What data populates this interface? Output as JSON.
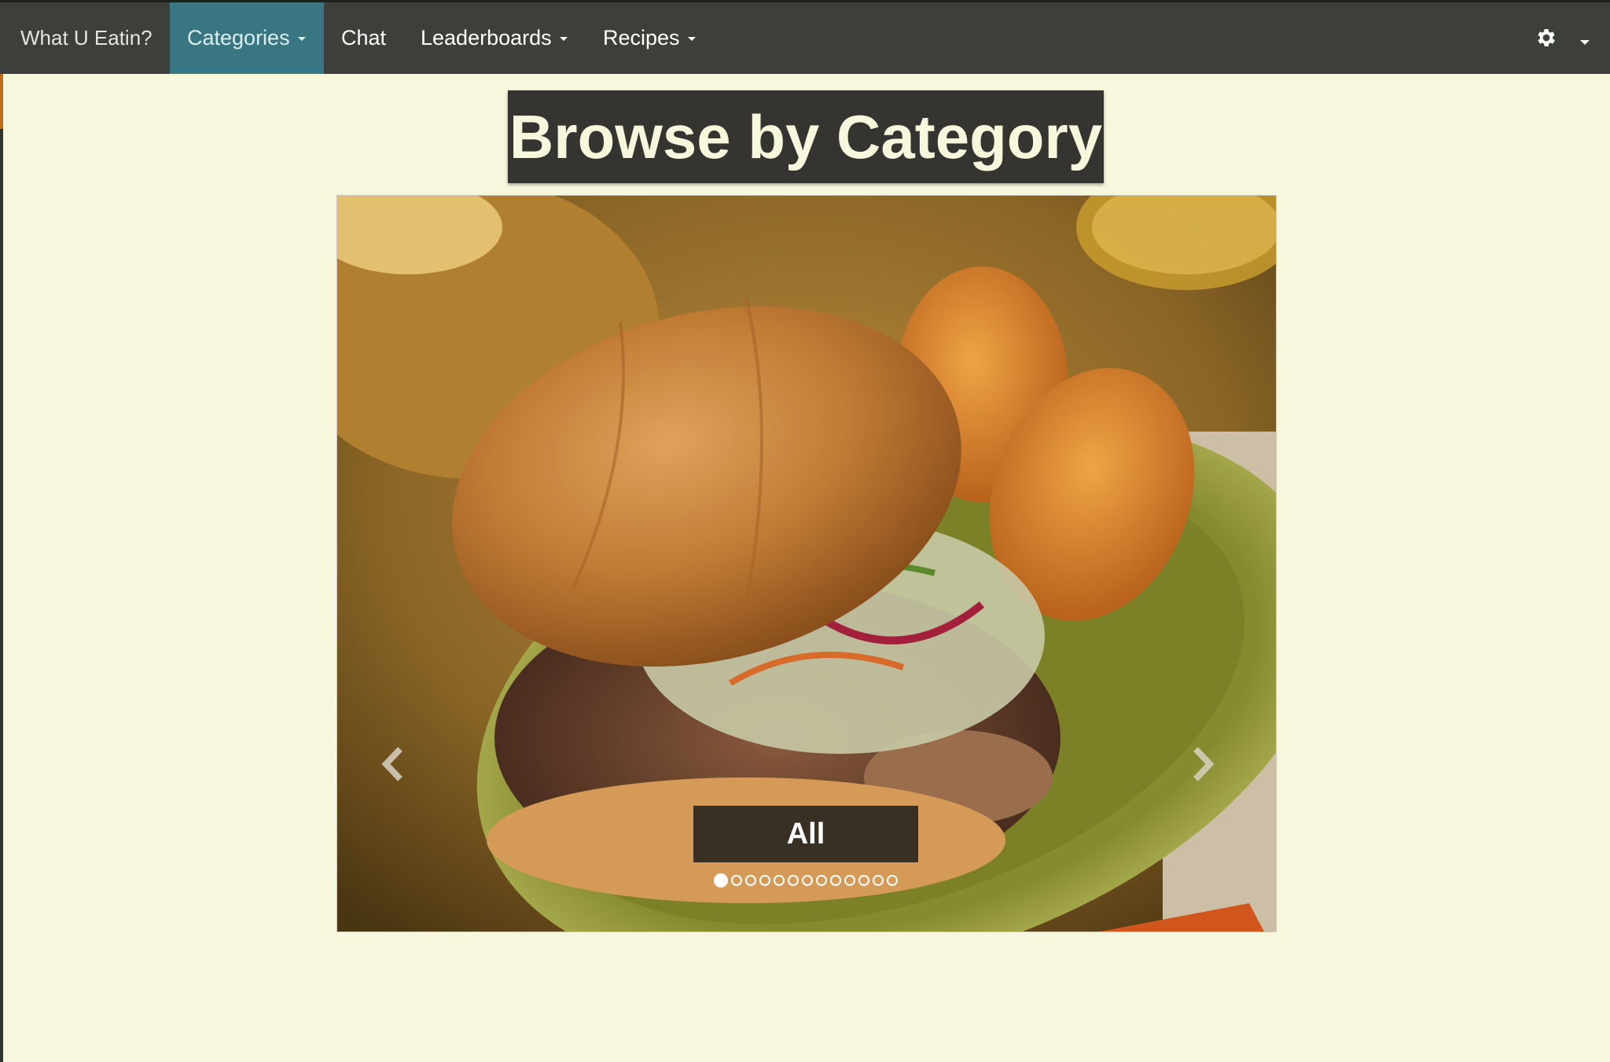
{
  "navbar": {
    "brand": "What U Eatin?",
    "items": [
      {
        "label": "Categories",
        "dropdown": true,
        "active": true
      },
      {
        "label": "Chat",
        "dropdown": false,
        "active": false
      },
      {
        "label": "Leaderboards",
        "dropdown": true,
        "active": false
      },
      {
        "label": "Recipes",
        "dropdown": true,
        "active": false
      }
    ],
    "settings_icon": "gear-icon",
    "user_menu_icon": "caret-down-icon"
  },
  "page": {
    "title": "Browse by Category"
  },
  "carousel": {
    "caption": "All",
    "slide_count": 13,
    "active_index": 0,
    "prev_icon": "chevron-left-icon",
    "next_icon": "chevron-right-icon"
  },
  "colors": {
    "navbar_bg": "#3d403a",
    "active_tab_bg": "#3a7682",
    "page_bg": "#f6f7dc",
    "title_bg": "#353431",
    "title_text": "#f6f7dc"
  }
}
